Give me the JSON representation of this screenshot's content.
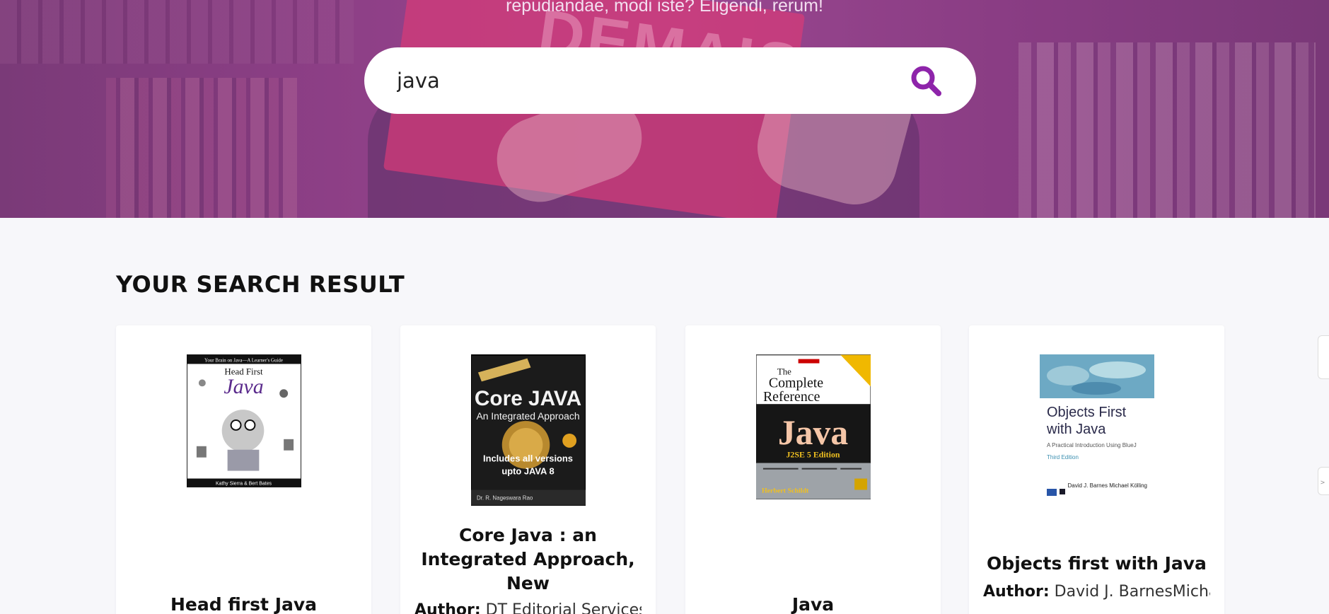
{
  "hero": {
    "tagline": "repudiandae, modi iste? Eligendi, rerum!",
    "cover_text": "DEMAIS"
  },
  "search": {
    "value": "java",
    "button_icon": "search-icon"
  },
  "results": {
    "heading": "YOUR SEARCH RESULT",
    "author_label": "Author:",
    "books": [
      {
        "title": "Head first Java",
        "author": "",
        "cover": {
          "top_text": "Your Brain on Java—A Learner's Guide",
          "line1": "Head First",
          "line2": "Java",
          "bottom_text": "Kathy Sierra & Bert Bates"
        }
      },
      {
        "title": "Core Java : an Integrated Approach, New",
        "author": "DT Editorial Services R",
        "cover": {
          "line1": "Core JAVA",
          "line2": "An Integrated Approach",
          "line3": "Includes all versions",
          "line4": "upto JAVA 8",
          "bottom_text": "Dr. R. Nageswara Rao"
        }
      },
      {
        "title": "Java",
        "author": "",
        "cover": {
          "line1": "The",
          "line2": "Complete",
          "line3": "Reference",
          "line4": "Java",
          "line5": "J2SE 5 Edition",
          "bottom_text": "Herbert Schildt"
        }
      },
      {
        "title": "Objects first with Java",
        "author": "David J. BarnesMichael KollingDavid",
        "cover": {
          "line1": "Objects First",
          "line2": "with Java",
          "line3": "A Practical Introduction Using BlueJ",
          "line4": "Third Edition",
          "bottom_text": "David J. Barnes Michael Kölling"
        }
      }
    ]
  },
  "colors": {
    "accent": "#8e24aa",
    "hero_overlay": "#8d3f86"
  }
}
